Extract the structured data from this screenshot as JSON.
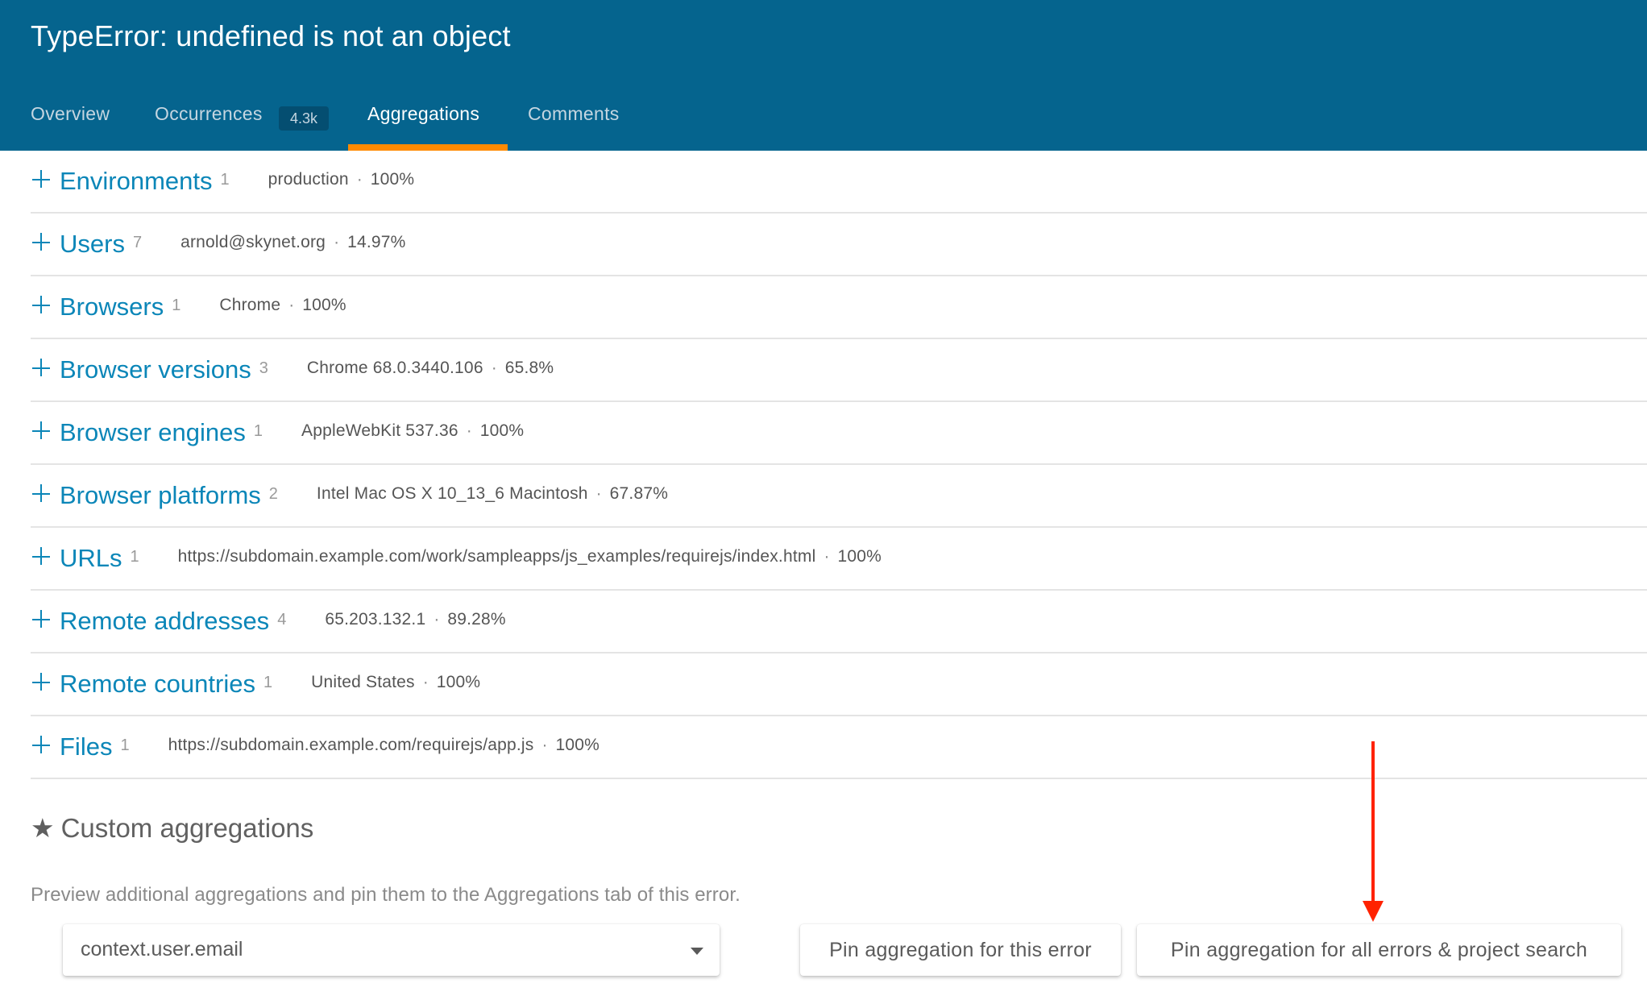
{
  "header": {
    "title": "TypeError: undefined is not an object",
    "tabs": [
      {
        "label": "Overview",
        "active": false
      },
      {
        "label": "Occurrences",
        "badge": "4.3k",
        "active": false
      },
      {
        "label": "Aggregations",
        "active": true
      },
      {
        "label": "Comments",
        "active": false
      }
    ],
    "active_tab_color": "#ff8a00",
    "background_color": "#05648e"
  },
  "aggregations": [
    {
      "icon": "plus-icon",
      "label": "Environments",
      "count": "1",
      "top_value": "production",
      "percent": "100%"
    },
    {
      "icon": "plus-icon",
      "label": "Users",
      "count": "7",
      "top_value": "arnold@skynet.org",
      "percent": "14.97%"
    },
    {
      "icon": "plus-icon",
      "label": "Browsers",
      "count": "1",
      "top_value": "Chrome",
      "percent": "100%"
    },
    {
      "icon": "plus-icon",
      "label": "Browser versions",
      "count": "3",
      "top_value": "Chrome 68.0.3440.106",
      "percent": "65.8%"
    },
    {
      "icon": "plus-icon",
      "label": "Browser engines",
      "count": "1",
      "top_value": "AppleWebKit 537.36",
      "percent": "100%"
    },
    {
      "icon": "plus-icon",
      "label": "Browser platforms",
      "count": "2",
      "top_value": "Intel Mac OS X 10_13_6 Macintosh",
      "percent": "67.87%"
    },
    {
      "icon": "plus-icon",
      "label": "URLs",
      "count": "1",
      "top_value": "https://subdomain.example.com/work/sampleapps/js_examples/requirejs/index.html",
      "percent": "100%"
    },
    {
      "icon": "plus-icon",
      "label": "Remote addresses",
      "count": "4",
      "top_value": "65.203.132.1",
      "percent": "89.28%"
    },
    {
      "icon": "plus-icon",
      "label": "Remote countries",
      "count": "1",
      "top_value": "United States",
      "percent": "100%"
    },
    {
      "icon": "plus-icon",
      "label": "Files",
      "count": "1",
      "top_value": "https://subdomain.example.com/requirejs/app.js",
      "percent": "100%"
    }
  ],
  "separator": "·",
  "custom": {
    "icon": "star-icon",
    "star_glyph": "★",
    "title": "Custom aggregations",
    "description": "Preview additional aggregations and pin them to the Aggregations tab of this error.",
    "select_value": "context.user.email",
    "pin_this_label": "Pin aggregation for this error",
    "pin_all_label": "Pin aggregation for all errors & project search"
  },
  "annotation": {
    "type": "arrow",
    "color": "#ff2200",
    "points_to": "Pin aggregation for all errors & project search"
  }
}
